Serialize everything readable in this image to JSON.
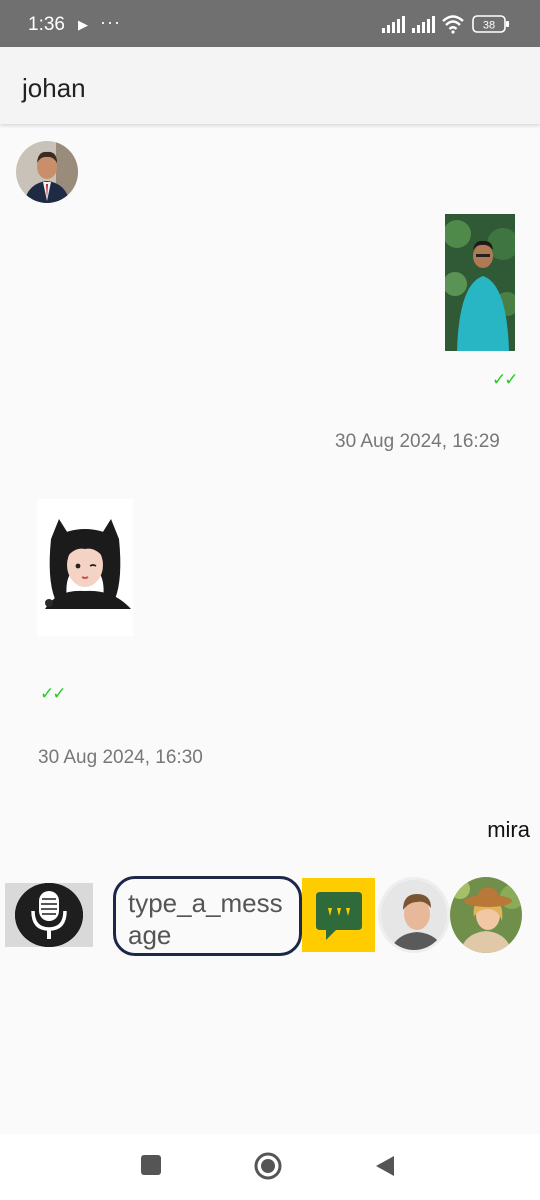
{
  "status_bar": {
    "time": "1:36",
    "battery": "38",
    "icons": [
      "play-icon",
      "more-dots-icon",
      "signal-icon",
      "signal-icon",
      "wifi-icon",
      "battery-icon"
    ]
  },
  "app_bar": {
    "title": "johan"
  },
  "messages": [
    {
      "type": "image",
      "side": "right",
      "content": "photo-man-teal-shirt",
      "ticks": "✓✓",
      "timestamp": "30 Aug 2024, 16:29"
    },
    {
      "type": "image",
      "side": "left",
      "content": "anime-cat-girl-sticker",
      "ticks": "✓✓",
      "timestamp": "30 Aug 2024, 16:30"
    }
  ],
  "receiver_name": "mira",
  "composer": {
    "placeholder": "type_a_message",
    "mic_icon": "microphone-icon",
    "chat_icon": "chat-bubble-icon"
  },
  "colors": {
    "status_bar": "#707070",
    "ticks": "#22cc22",
    "input_border": "#1c2749",
    "chat_button": "#ffcc00",
    "chat_bubble": "#2f6b3a"
  },
  "nav_bar": {
    "icons": [
      "square-recents-icon",
      "circle-home-icon",
      "triangle-back-icon"
    ]
  }
}
